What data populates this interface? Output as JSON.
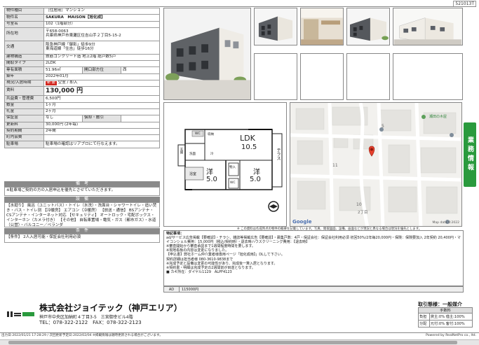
{
  "doc_id": "521013T",
  "property": {
    "rows": [
      {
        "label": "物件種目",
        "value": "［住居用］マンション"
      },
      {
        "label": "物件名",
        "value": "SAKURA　MAISON【旭化成】"
      },
      {
        "label": "号室名",
        "value": "102（1階部分）"
      },
      {
        "label": "所在地",
        "value": "〒658-0063\n兵庫県神戸市東灘区住吉山手２丁目5-15-2"
      },
      {
        "label": "交通",
        "value": "阪急神戸線「御影」徒歩9分\n東海道線「住吉」徒歩16分"
      },
      {
        "label": "建物構造",
        "value": "鉄筋コンクリート造 地上2階 総戸数5戸"
      },
      {
        "label": "間取タイプ",
        "value": "2LDK"
      },
      {
        "label": "専有面積",
        "value": "51.96㎡",
        "label2": "開口部方位",
        "value2": "西"
      },
      {
        "label": "築年",
        "value": "2022年01月"
      },
      {
        "label": "現況/入居時期",
        "badge": "新 築",
        "value": "空室 / 即入"
      },
      {
        "label": "賃料",
        "value": "130,000 円"
      },
      {
        "label": "共益費・管理費",
        "value": "6,500円"
      },
      {
        "label": "敷金",
        "value": "1ヶ月"
      },
      {
        "label": "礼金",
        "value": "2ヶ月"
      },
      {
        "label": "保証金",
        "value": "なし",
        "label2": "償却・敷引",
        "value2": ""
      },
      {
        "label": "更新料",
        "value": "30,000円 (2年毎)"
      },
      {
        "label": "契約期間",
        "value": "2年間"
      },
      {
        "label": "町内会費",
        "value": ""
      },
      {
        "label": "駐車場",
        "value": "駐車場の確認はリアプロにて行なえます。"
      }
    ]
  },
  "sections": {
    "remarks_title": "備　考",
    "remarks_text": "※駐車場ご契約の方の入居申込を優先とさせていただきます。",
    "facilities_title": "設　備",
    "facilities_text": "【水廻り】 風呂（ユニットバス）・トイレ（水洗）・洗面台・シャワートイレ・追い焚き・バス・トイレ別 【冷暖房】 エアコン（冷暖房） 【放送・通信】 BSアンテナ・CSアンテナ・インターネット対応 【セキュリティ】 オートロック・宅配ボックス・インターホン（カメラ付き） 【その他】 自転車置場・電気・ガス（都市ガス）・水道（公営）・バルコニー／ベランダ",
    "conditions_title": "条　件",
    "conditions_text": "【条件】 2人入居可能・保証会社利用必須"
  },
  "floorplan": {
    "ldk_label": "LDK",
    "ldk_size": "10.5",
    "room1_label": "洋",
    "room1_size": "5.0",
    "room2_label": "洋",
    "room2_size": "5.0",
    "terrace": "テラス",
    "storage": "収納",
    "entrance": "玄関",
    "washroom": "洗面",
    "bath": "浴室",
    "toilet": "WC",
    "closet": "物入",
    "kitchen": "冷",
    "wc2": "WC"
  },
  "map": {
    "labels": [
      "5",
      "11",
      "10",
      "2丁目"
    ],
    "poi": "瀬田の木屋",
    "footer_left": "Google",
    "footer_right": "Map data ©2022"
  },
  "map_note": "※ この資料は作成時点の物件の概要を記載しています。写真、間取図面、設備、画面などが現況と異なる場合は現況を優先とします。",
  "side_button": "業務情報",
  "remarks_box": {
    "title": "特記事項：",
    "lines": [
      "ad/サービス広告掲載【要確認】・チラシ、雑誌等掲載広告【要確認】・募集戸数：4戸・保証会社：保証会社利用必須 初回50%/2年毎20,000円・保険：保険要加入 2年契約 20,400円・マイコンシェル費用：15,000円（税込/契約時）・退去時ハウスクリーニング費用：【退去時】",
      "※審査開始から審査承認まで1週間程度時間を要します。",
      "※現地看板の内容は変更になりました。",
      "【申込書】弊社ホーム仲介業者様専用ページ「旭化成両】」DLして下さい。",
      "契約詳細は担当者様 080-3610-9838まで",
      "※完成予定と設備は変更の可能性があり、完成後一算入居となります。",
      "※契約書・明細は完成予定の2週間前が目途となります。",
      "■ カギ所在：ダイヤル1129　ALPF4123"
    ]
  },
  "ad_bar": {
    "code": "AD",
    "value": "115000円"
  },
  "company": {
    "name": "株式会社ジョイテック（神戸エリア）",
    "address": "神戸市中央区加納町４丁目3-5　三宮御幸ビル4階",
    "tel": "TEL：078-322-2122　FAX：078-322-2123"
  },
  "trade": {
    "title": "取引態様：一般媒介",
    "header": "手数料",
    "rows": [
      {
        "label": "負担",
        "value": "貸主:0%  借主:100%"
      },
      {
        "label": "分配",
        "value": "元付:0%  客付:100%"
      }
    ]
  },
  "footer": {
    "left": "出力日:2022/01/21 17:28:29 / 次回更新予定日:2022/02/04 ※掲載情報は随時更新される場合がございます。",
    "right": "Powered by RealNetPro co., ltd."
  },
  "colors": {
    "accent_green": "#2a9a3d",
    "label_gray": "#e3e3e3",
    "new_red": "#d2271f"
  }
}
